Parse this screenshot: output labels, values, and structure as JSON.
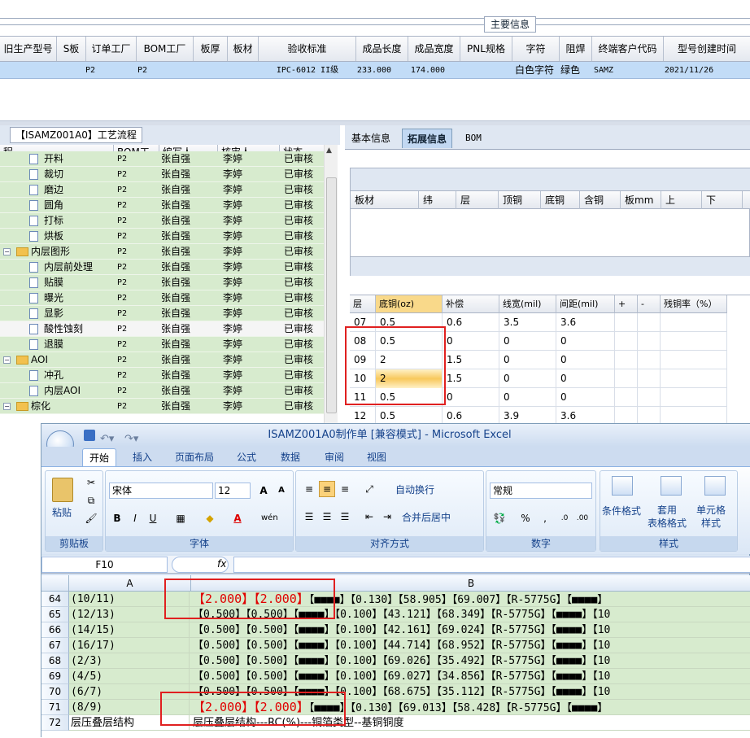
{
  "top": {
    "group_title": "主要信息",
    "columns": [
      "旧生产型号",
      "S板",
      "订单工厂",
      "BOM工厂",
      "板厚",
      "板材",
      "验收标准",
      "成品长度",
      "成品宽度",
      "PNL规格",
      "字符",
      "阻焊",
      "终端客户代码",
      "型号创建时间"
    ],
    "row": [
      "",
      "",
      "P2",
      "P2",
      "",
      "",
      "IPC-6012 II级",
      "233.000",
      "174.000",
      "",
      "白色字符",
      "绿色",
      "SAMZ",
      "2021/11/26"
    ]
  },
  "left": {
    "title": "【ISAMZ001A0】工艺流程",
    "columns": [
      "程",
      "BOM工厂",
      "编写人",
      "核审人",
      "状态"
    ],
    "rows": [
      {
        "name": "开料",
        "type": "doc",
        "factory": "P2",
        "writer": "张自强",
        "reviewer": "李婷",
        "status": "已审核"
      },
      {
        "name": "裁切",
        "type": "doc",
        "factory": "P2",
        "writer": "张自强",
        "reviewer": "李婷",
        "status": "已审核"
      },
      {
        "name": "磨边",
        "type": "doc",
        "factory": "P2",
        "writer": "张自强",
        "reviewer": "李婷",
        "status": "已审核"
      },
      {
        "name": "圆角",
        "type": "doc",
        "factory": "P2",
        "writer": "张自强",
        "reviewer": "李婷",
        "status": "已审核"
      },
      {
        "name": "打标",
        "type": "doc",
        "factory": "P2",
        "writer": "张自强",
        "reviewer": "李婷",
        "status": "已审核"
      },
      {
        "name": "烘板",
        "type": "doc",
        "factory": "P2",
        "writer": "张自强",
        "reviewer": "李婷",
        "status": "已审核"
      },
      {
        "name": "内层图形",
        "type": "folder",
        "factory": "P2",
        "writer": "张自强",
        "reviewer": "李婷",
        "status": "已审核"
      },
      {
        "name": "内层前处理",
        "type": "doc",
        "factory": "P2",
        "writer": "张自强",
        "reviewer": "李婷",
        "status": "已审核"
      },
      {
        "name": "贴膜",
        "type": "doc",
        "factory": "P2",
        "writer": "张自强",
        "reviewer": "李婷",
        "status": "已审核"
      },
      {
        "name": "曝光",
        "type": "doc",
        "factory": "P2",
        "writer": "张自强",
        "reviewer": "李婷",
        "status": "已审核"
      },
      {
        "name": "显影",
        "type": "doc",
        "factory": "P2",
        "writer": "张自强",
        "reviewer": "李婷",
        "status": "已审核"
      },
      {
        "name": "酸性蚀刻",
        "type": "doc",
        "factory": "P2",
        "writer": "张自强",
        "reviewer": "李婷",
        "status": "已审核",
        "selected": true
      },
      {
        "name": "退膜",
        "type": "doc",
        "factory": "P2",
        "writer": "张自强",
        "reviewer": "李婷",
        "status": "已审核"
      },
      {
        "name": "AOI",
        "type": "folder",
        "factory": "P2",
        "writer": "张自强",
        "reviewer": "李婷",
        "status": "已审核"
      },
      {
        "name": "冲孔",
        "type": "doc",
        "factory": "P2",
        "writer": "张自强",
        "reviewer": "李婷",
        "status": "已审核"
      },
      {
        "name": "内层AOI",
        "type": "doc",
        "factory": "P2",
        "writer": "张自强",
        "reviewer": "李婷",
        "status": "已审核"
      },
      {
        "name": "棕化",
        "type": "folder",
        "factory": "P2",
        "writer": "张自强",
        "reviewer": "李婷",
        "status": "已审核"
      }
    ]
  },
  "right": {
    "tabs": [
      "基本信息",
      "拓展信息",
      "BOM"
    ],
    "grid1_columns": [
      "板材",
      "纬",
      "层",
      "顶铜",
      "底铜",
      "含铜",
      "板mm",
      "上",
      "下"
    ],
    "grid2_columns": [
      "层",
      "底铜(oz)",
      "补偿",
      "线宽(mil)",
      "间距(mil)",
      "+",
      "-",
      "残铜率（%）"
    ],
    "grid2_rows": [
      [
        "07",
        "0.5",
        "0.6",
        "3.5",
        "3.6"
      ],
      [
        "08",
        "0.5",
        "0",
        "0",
        "0"
      ],
      [
        "09",
        "2",
        "1.5",
        "0",
        "0"
      ],
      [
        "10",
        "2",
        "1.5",
        "0",
        "0"
      ],
      [
        "11",
        "0.5",
        "0",
        "0",
        "0"
      ],
      [
        "12",
        "0.5",
        "0.6",
        "3.9",
        "3.6"
      ]
    ]
  },
  "excel": {
    "title": "ISAMZ001A0制作单 [兼容模式] - Microsoft Excel",
    "tabs": [
      "开始",
      "插入",
      "页面布局",
      "公式",
      "数据",
      "审阅",
      "视图"
    ],
    "groups": {
      "clipboard": "剪贴板",
      "font": "字体",
      "align": "对齐方式",
      "number": "数字",
      "style": "样式"
    },
    "paste": "粘贴",
    "font_name": "宋体",
    "font_size": "12",
    "wrap": "自动换行",
    "merge": "合并后居中",
    "number_format": "常规",
    "cond_format": "条件格式",
    "table_format": "套用\n表格格式",
    "cell_style": "单元格\n样式",
    "name_box": "F10",
    "fx": "fx",
    "col_a": "A",
    "col_b": "B",
    "rows": [
      {
        "n": "64",
        "a": "(10/11)",
        "red": [
          "【2.000】",
          "【2.000】"
        ],
        "b": "【■■■■】【0.130】【58.905】【69.007】【R-5775G】【■■■■】"
      },
      {
        "n": "65",
        "a": "(12/13)",
        "red": null,
        "b": "【0.500】【0.500】【■■■■】【0.100】【43.121】【68.349】【R-5775G】【■■■■】【10"
      },
      {
        "n": "66",
        "a": "(14/15)",
        "red": null,
        "b": "【0.500】【0.500】【■■■■】【0.100】【42.161】【69.024】【R-5775G】【■■■■】【10"
      },
      {
        "n": "67",
        "a": "(16/17)",
        "red": null,
        "b": "【0.500】【0.500】【■■■■】【0.100】【44.714】【68.952】【R-5775G】【■■■■】【10"
      },
      {
        "n": "68",
        "a": "(2/3)",
        "red": null,
        "b": "【0.500】【0.500】【■■■■】【0.100】【69.026】【35.492】【R-5775G】【■■■■】【10"
      },
      {
        "n": "69",
        "a": "(4/5)",
        "red": null,
        "b": "【0.500】【0.500】【■■■■】【0.100】【69.027】【34.856】【R-5775G】【■■■■】【10"
      },
      {
        "n": "70",
        "a": "(6/7)",
        "red": null,
        "b": "【0.500】【0.500】【■■■■】【0.100】【68.675】【35.112】【R-5775G】【■■■■】【10"
      },
      {
        "n": "71",
        "a": "(8/9)",
        "red": [
          "【2.000】",
          "【2.000】"
        ],
        "b": "【■■■■】【0.130】【69.013】【58.428】【R-5775G】【■■■■】"
      },
      {
        "n": "72",
        "a": "层压叠层结构",
        "red": null,
        "b": "层压叠层结构---RC(%)---铜箔类型--基铜铜度"
      }
    ]
  }
}
